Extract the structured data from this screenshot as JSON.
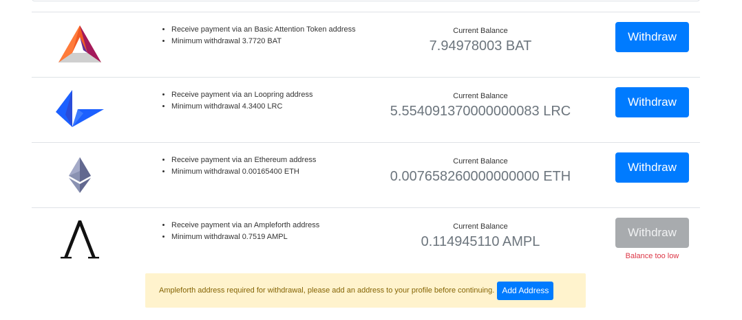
{
  "rows": [
    {
      "currency": "BAT",
      "icon": "basic-attention-token-icon",
      "bullets": [
        "Receive payment via an Basic Attention Token address",
        "Minimum withdrawal 3.7720 BAT"
      ],
      "balance_label": "Current Balance",
      "balance_value": "7.94978003 BAT",
      "button_label": "Withdraw",
      "button_enabled": true,
      "error": ""
    },
    {
      "currency": "LRC",
      "icon": "loopring-icon",
      "bullets": [
        "Receive payment via an Loopring address",
        "Minimum withdrawal 4.3400 LRC"
      ],
      "balance_label": "Current Balance",
      "balance_value": "5.554091370000000083 LRC",
      "button_label": "Withdraw",
      "button_enabled": true,
      "error": ""
    },
    {
      "currency": "ETH",
      "icon": "ethereum-icon",
      "bullets": [
        "Receive payment via an Ethereum address",
        "Minimum withdrawal 0.00165400 ETH"
      ],
      "balance_label": "Current Balance",
      "balance_value": "0.007658260000000000 ETH",
      "button_label": "Withdraw",
      "button_enabled": true,
      "error": ""
    },
    {
      "currency": "AMPL",
      "icon": "ampleforth-icon",
      "bullets": [
        "Receive payment via an Ampleforth address",
        "Minimum withdrawal 0.7519 AMPL"
      ],
      "balance_label": "Current Balance",
      "balance_value": "0.114945110 AMPL",
      "button_label": "Withdraw",
      "button_enabled": false,
      "error": "Balance too low"
    }
  ],
  "alert": {
    "message": "Ampleforth address required for withdrawal, please add an address to your profile before continuing.",
    "button_label": "Add Address"
  },
  "colors": {
    "primary": "#007bff",
    "disabled": "#a8abae",
    "danger": "#dc3545",
    "warning_bg": "#fff3cd",
    "warning_text": "#856404"
  }
}
